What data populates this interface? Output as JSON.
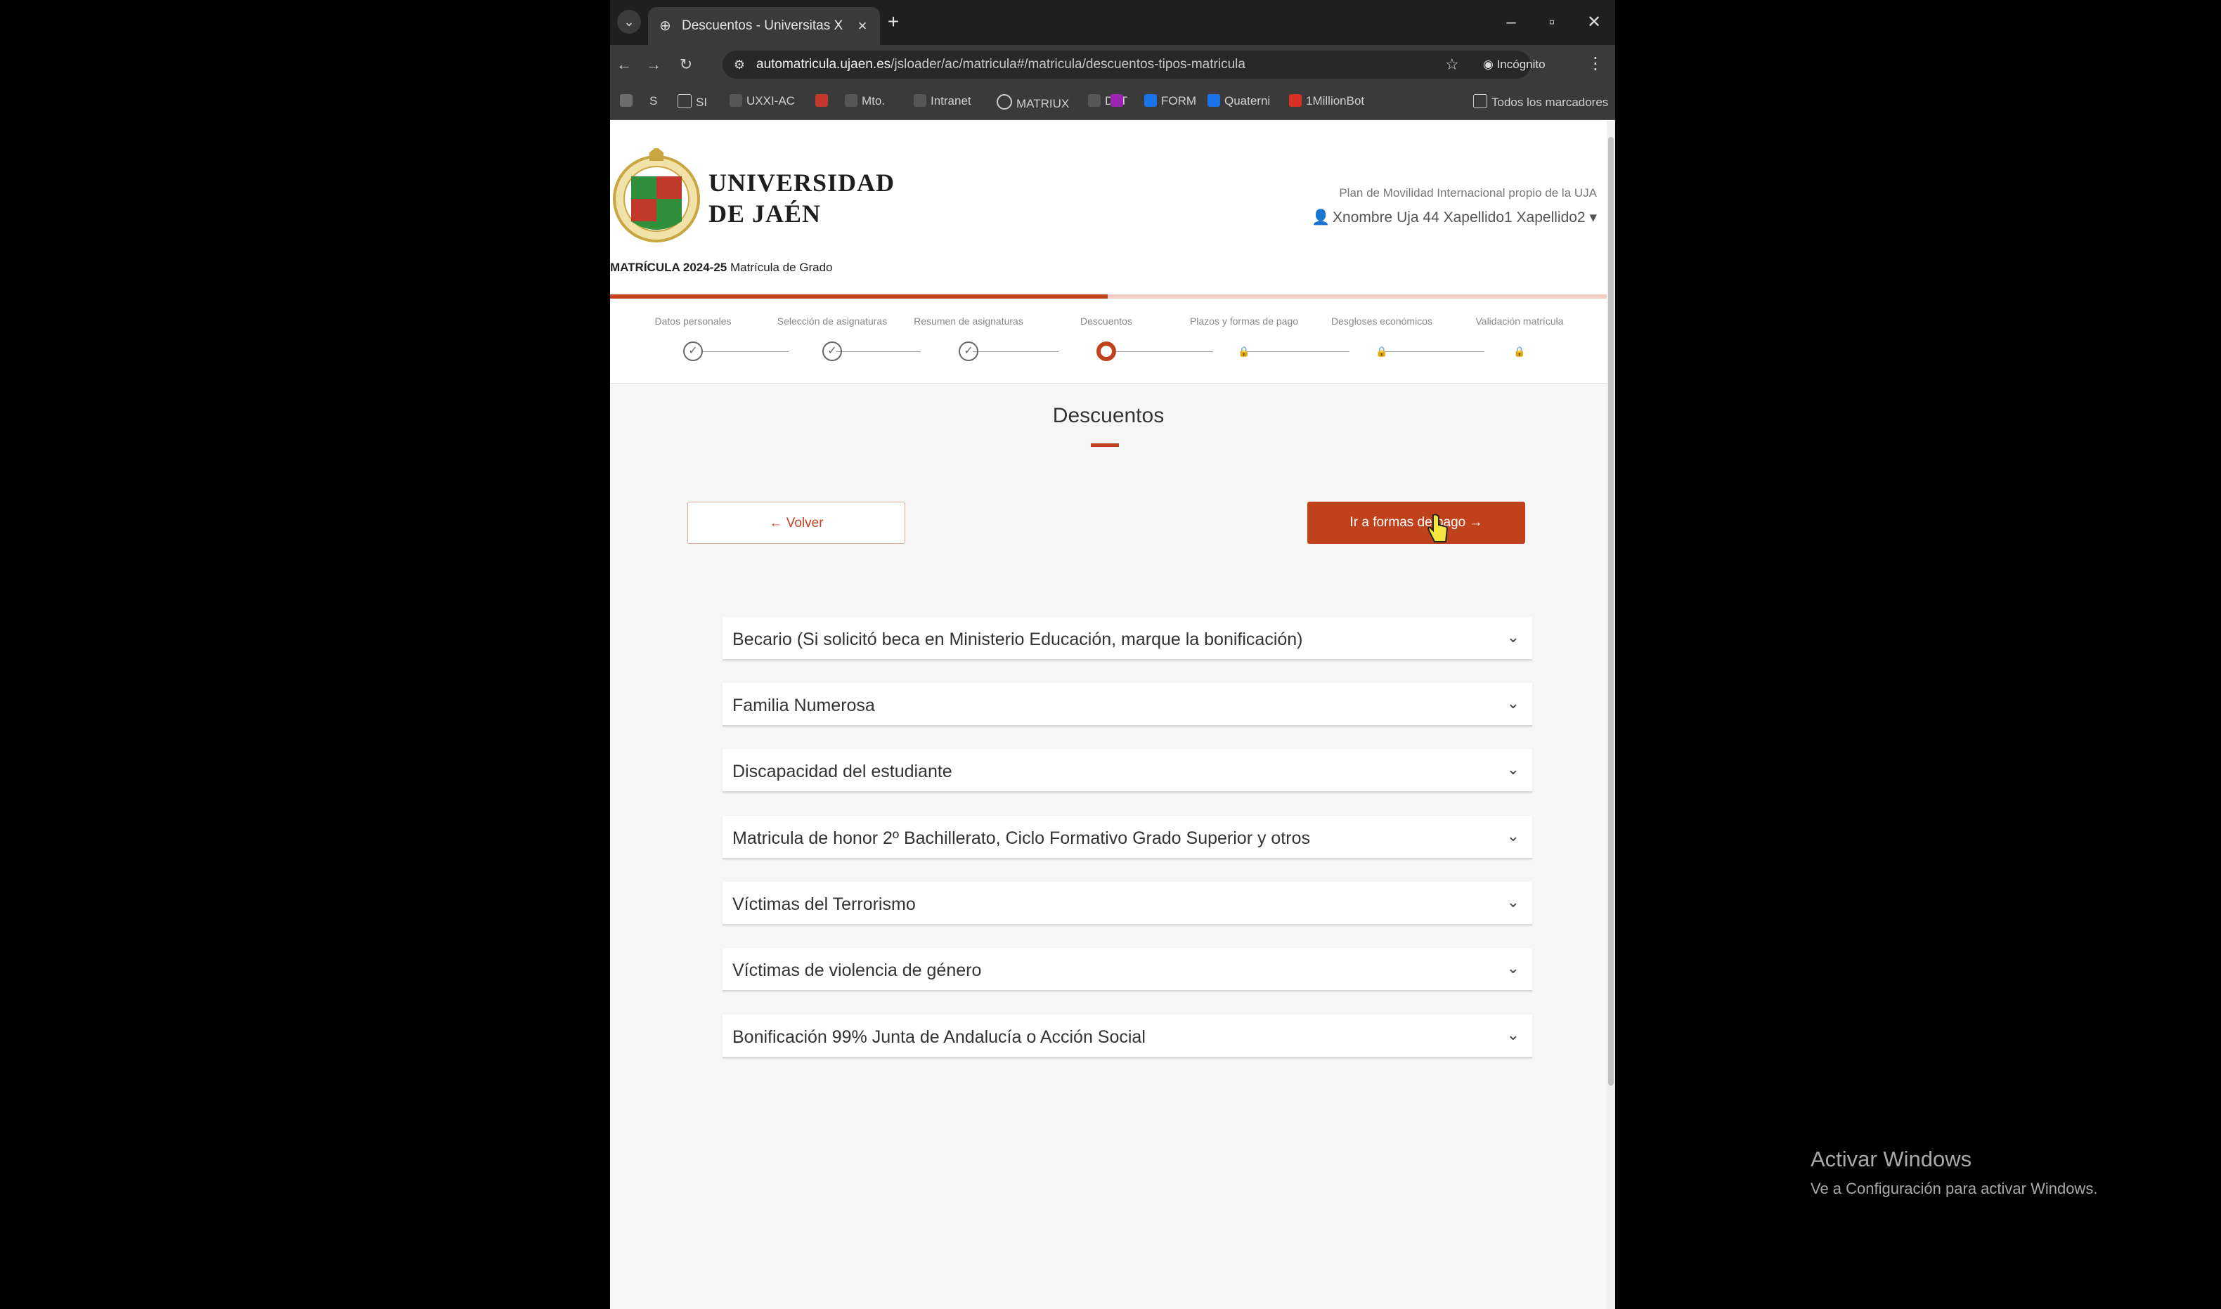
{
  "browser": {
    "tab_title": "Descuentos - Universitas XXI",
    "url_host": "automatricula.ujaen.es",
    "url_path": "/jsloader/ac/matricula#/matricula/descuentos-tipos-matricula",
    "incognito_label": "Incógnito",
    "bookmarks": [
      {
        "label": "",
        "color": "#6d6d6d"
      },
      {
        "label": "S",
        "color": "#3a3a3a"
      },
      {
        "label": "SI",
        "color": "#3a3a3a"
      },
      {
        "label": "UXXI-AC",
        "color": "#555555"
      },
      {
        "label": "",
        "color": "#c0392b"
      },
      {
        "label": "Mto.",
        "color": "#555555"
      },
      {
        "label": "Intranet",
        "color": "#555555"
      },
      {
        "label": "MATRIUX",
        "color": "#3a3a3a"
      },
      {
        "label": "DaT",
        "color": "#555555"
      },
      {
        "label": "",
        "color": "#9b27b0"
      },
      {
        "label": "FORM",
        "color": "#1a73e8"
      },
      {
        "label": "Quaterni",
        "color": "#1a73e8"
      },
      {
        "label": "1MillionBot",
        "color": "#d93025"
      }
    ],
    "all_bookmarks_label": "Todos los marcadores"
  },
  "header": {
    "university_line1": "UNIVERSIDAD",
    "university_line2": "DE JAÉN",
    "matricula_bold": "MATRÍCULA 2024-25",
    "matricula_rest": "Matrícula de Grado",
    "plan_text": "Plan de Movilidad Internacional propio de la UJA",
    "user_name": "Xnombre Uja 44 Xapellido1 Xapellido2"
  },
  "steps": [
    {
      "label": "Datos personales",
      "state": "done"
    },
    {
      "label": "Selección de asignaturas",
      "state": "done"
    },
    {
      "label": "Resumen de asignaturas",
      "state": "done"
    },
    {
      "label": "Descuentos",
      "state": "current"
    },
    {
      "label": "Plazos y formas de pago",
      "state": "locked"
    },
    {
      "label": "Desgloses económicos",
      "state": "locked"
    },
    {
      "label": "Validación matrícula",
      "state": "locked"
    }
  ],
  "main": {
    "title": "Descuentos",
    "back_label": "Volver",
    "next_label": "Ir a formas de pago",
    "discounts": [
      "Becario (Si solicitó beca en Ministerio Educación, marque la bonificación)",
      "Familia Numerosa",
      "Discapacidad del estudiante",
      "Matricula de honor 2º Bachillerato, Ciclo Formativo Grado Superior y otros",
      "Víctimas del Terrorismo",
      "Víctimas de violencia de género",
      "Bonificación 99% Junta de Andalucía o Acción Social"
    ]
  },
  "watermark": {
    "line1": "Activar Windows",
    "line2": "Ve a Configuración para activar Windows."
  },
  "colors": {
    "accent": "#c0421d",
    "page_bg": "#f6f6f6"
  }
}
